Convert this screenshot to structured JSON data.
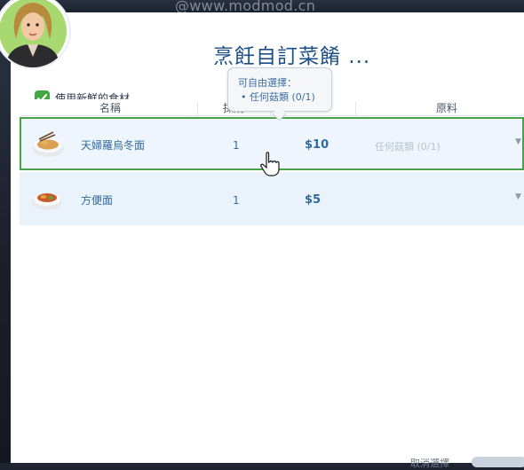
{
  "watermark": "@www.modmod.cn",
  "title": "烹飪自訂菜餚 ...",
  "fresh_ingredients": {
    "checked": true,
    "label": "使用新鮮的食材"
  },
  "table": {
    "columns": {
      "name": "名稱",
      "quantity": "採購",
      "ingredients": "原料"
    },
    "rows": [
      {
        "name": "天婦羅烏冬面",
        "quantity": "1",
        "price": "$10",
        "ingredients": "任何菇類 (0/1)",
        "selected": true
      },
      {
        "name": "方便面",
        "quantity": "1",
        "price": "$5",
        "ingredients": "",
        "selected": false
      }
    ]
  },
  "tooltip": {
    "heading": "可自由選擇：",
    "item": "• 任何菇類 (0/1)"
  },
  "footer": {
    "link": "取消選擇"
  },
  "colors": {
    "title": "#1b4f86",
    "accent_green": "#48a24a",
    "row_bg": "#eaf3fb",
    "price": "#2f6a9f"
  }
}
